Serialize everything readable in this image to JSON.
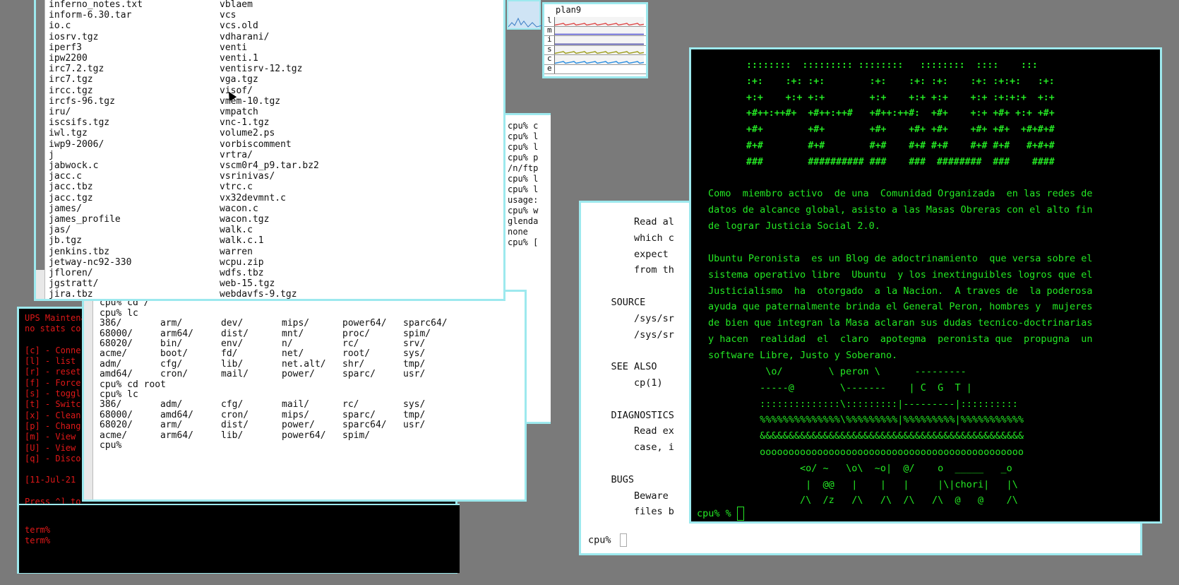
{
  "desktop": {
    "background": "#7a7a7a",
    "border_color": "#9de9ee"
  },
  "file_listing": {
    "col1": [
      "inferno_notes.txt",
      "inform-6.30.tar",
      "io.c",
      "iosrv.tgz",
      "iperf3",
      "ipw2200",
      "irc7.2.tgz",
      "irc7.tgz",
      "ircc.tgz",
      "ircfs-96.tgz",
      "iru/",
      "iscsifs.tgz",
      "iwl.tgz",
      "iwp9-2006/",
      "j",
      "jabwock.c",
      "jacc.c",
      "jacc.tbz",
      "jacc.tgz",
      "james/",
      "james_profile",
      "jas/",
      "jb.tgz",
      "jenkins.tbz",
      "jetway-nc92-330",
      "jfloren/",
      "jgstratt/",
      "jira.tbz"
    ],
    "col2": [
      "vblaem",
      "vcs",
      "vcs.old",
      "vdharani/",
      "venti",
      "venti.1",
      "ventisrv-12.tgz",
      "vga.tgz",
      "visof/",
      "vmem-10.tgz",
      "vmpatch",
      "vnc-1.tgz",
      "volume2.ps",
      "vorbiscomment",
      "vrtra/",
      "vscm0r4_p9.tar.bz2",
      "vsrinivas/",
      "vtrc.c",
      "vx32devmnt.c",
      "wacon.c",
      "wacon.tgz",
      "walk.c",
      "walk.c.1",
      "warren",
      "wcpu.zip",
      "wdfs.tbz",
      "web-15.tgz",
      "webdavfs-9.tgz"
    ]
  },
  "term_ls": {
    "partial_top": [
      "amd64/",
      "cron/",
      "mail/",
      "power/",
      "sparc/",
      "usr/"
    ],
    "cmd1": "cpu% cd /",
    "cmd2": "cpu% lc",
    "root_ls": [
      [
        "386/",
        "arm/",
        "dev/",
        "mips/",
        "power64/",
        "sparc64/"
      ],
      [
        "68000/",
        "arm64/",
        "dist/",
        "mnt/",
        "proc/",
        "spim/"
      ],
      [
        "68020/",
        "bin/",
        "env/",
        "n/",
        "rc/",
        "srv/"
      ],
      [
        "acme/",
        "boot/",
        "fd/",
        "net/",
        "root/",
        "sys/"
      ],
      [
        "adm/",
        "cfg/",
        "lib/",
        "net.alt/",
        "shr/",
        "tmp/"
      ],
      [
        "amd64/",
        "cron/",
        "mail/",
        "power/",
        "sparc/",
        "usr/"
      ]
    ],
    "cmd3": "cpu% cd root",
    "cmd4": "cpu% lc",
    "rootdir_ls": [
      [
        "386/",
        "adm/",
        "cfg/",
        "mail/",
        "rc/",
        "sys/"
      ],
      [
        "68000/",
        "amd64/",
        "cron/",
        "mips/",
        "sparc/",
        "tmp/"
      ],
      [
        "68020/",
        "arm/",
        "dist/",
        "power/",
        "sparc64/",
        "usr/"
      ],
      [
        "acme/",
        "arm64/",
        "lib/",
        "power64/",
        "spim/",
        ""
      ]
    ],
    "prompt": "cpu%"
  },
  "ups": {
    "lines": [
      "UPS Maintenance",
      "no stats co",
      "",
      "[c] - Conne",
      "[l] - list",
      "[r] - reset",
      "[f] - Force",
      "[s] - toggl",
      "[t] - Switc",
      "[x] - Clean",
      "[p] - Chang",
      "[m] - View",
      "[U] - View",
      "[q] - Disco",
      "",
      "[11-Jul-21",
      "",
      "Press ^] to"
    ],
    "term_lines": [
      "term%",
      "term%"
    ]
  },
  "side_term": {
    "lines": [
      "cpu% c",
      "cpu% l",
      "cpu% l",
      "cpu% p",
      "/n/ftp",
      "cpu% l",
      "cpu% l",
      "usage:",
      "cpu% w",
      "glenda",
      "none",
      "cpu% ["
    ]
  },
  "stats": {
    "title": "plan9",
    "labels": [
      "l",
      "m",
      "i",
      "s",
      "c",
      "e"
    ],
    "colors": [
      "#e05050",
      "#5050d0",
      "#4040a0",
      "#a0a020",
      "#3090e0",
      "#ffffff"
    ]
  },
  "man_page": {
    "lines": [
      "        Read al",
      "        which c",
      "        expect",
      "        from th",
      "",
      "    SOURCE",
      "        /sys/sr",
      "        /sys/sr",
      "",
      "    SEE ALSO",
      "        cp(1)",
      "",
      "    DIAGNOSTICS",
      "        Read ex",
      "        case, i",
      "",
      "    BUGS",
      "        Beware",
      "        files b"
    ],
    "prompt": "cpu%"
  },
  "green_term": {
    "art": [
      "::::::::  ::::::::: ::::::::   ::::::::  ::::    :::",
      ":+:    :+: :+:        :+:    :+: :+:    :+: :+:+:   :+:",
      "+:+    +:+ +:+        +:+    +:+ +:+    +:+ :+:+:+  +:+",
      "+#++:++#+  +#++:++#   +#++:++#:  +#+    +:+ +#+ +:+ +#+",
      "+#+        +#+        +#+    +#+ +#+    +#+ +#+  +#+#+#",
      "#+#        #+#        #+#    #+# #+#    #+# #+#   #+#+#",
      "###        ########## ###    ###  ########  ###    ####"
    ],
    "para1": [
      "Como  miembro activo  de una  Comunidad Organizada  en las redes de",
      "datos de alcance global, asisto a las Masas Obreras con el alto fin",
      "de lograr Justicia Social 2.0."
    ],
    "para2": [
      "Ubuntu Peronista  es un Blog de adoctrinamiento  que versa sobre el",
      "sistema operativo libre  Ubuntu  y los inextinguibles logros que el",
      "Justicialismo  ha  otorgado  a la Nacion.  A traves de  la poderosa",
      "ayuda que paternalmente brinda el General Peron, hombres y  mujeres",
      "de bien que integran la Masa aclaran sus dudas tecnico-doctrinarias",
      "y hacen  realidad  el  claro  apotegma  peronista que  propugna  un",
      "software Libre, Justo y Soberano."
    ],
    "art2": [
      "          \\o/        \\ peron \\      ---------",
      "         -----@        \\-------    | C  G  T |",
      "         ::::::::::::::\\:::::::::|---------|::::::::::",
      "         %%%%%%%%%%%%%%\\%%%%%%%%%|%%%%%%%%%|%%%%%%%%%%%",
      "         &&&&&&&&&&&&&&&&&&&&&&&&&&&&&&&&&&&&&&&&&&&&&&",
      "         oooooooooooooooooooooooooooooooooooooooooooooo",
      "                <o/ ~   \\o\\  ~o|  @/    o  _____   _o",
      "                 |  @@   |    |   |     |\\|chori|   |\\",
      "                /\\  /z   /\\   /\\  /\\   /\\  @   @    /\\"
    ],
    "prompt": "cpu% %"
  }
}
